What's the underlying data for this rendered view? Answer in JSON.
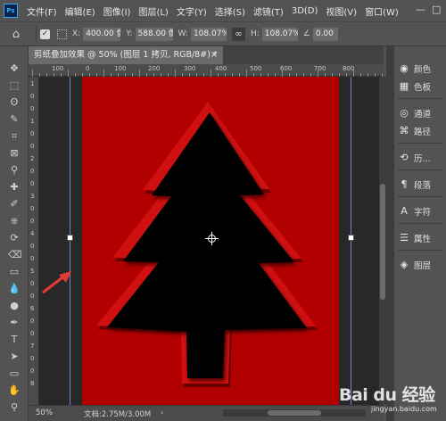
{
  "app": {
    "logo": "Ps"
  },
  "menu": [
    "文件(F)",
    "编辑(E)",
    "图像(I)",
    "图层(L)",
    "文字(Y)",
    "选择(S)",
    "滤镜(T)",
    "3D(D)",
    "视图(V)",
    "窗口(W)"
  ],
  "window_controls": {
    "minimize": "—",
    "maximize": "□"
  },
  "options": {
    "x_label": "X:",
    "x_value": "400.00 像素",
    "y_label": "Y:",
    "y_value": "588.00 像素",
    "w_label": "W:",
    "w_value": "108.07%",
    "h_label": "H:",
    "h_value": "108.07%",
    "angle_value": "0.00",
    "link_symbol": "∞"
  },
  "document": {
    "tab_title": "剪纸叠加效果 @ 50% (图层 1 拷贝, RGB/8#) *",
    "close": "×"
  },
  "ruler": {
    "top": [
      "100",
      "0",
      "100",
      "200",
      "300",
      "400",
      "500",
      "600",
      "700",
      "800"
    ],
    "left": [
      "1",
      "0",
      "0",
      "1",
      "0",
      "0",
      "2",
      "0",
      "0",
      "3",
      "0",
      "0",
      "4",
      "0",
      "0",
      "5",
      "0",
      "0",
      "6",
      "0",
      "0",
      "7",
      "0",
      "0",
      "8"
    ]
  },
  "status": {
    "zoom": "50%",
    "doc_size": "文档:2.75M/3.00M",
    "arrow": "›"
  },
  "panels": [
    {
      "icon": "palette-icon",
      "glyph": "◉",
      "label": "颜色"
    },
    {
      "icon": "swatches-icon",
      "glyph": "▦",
      "label": "色板"
    },
    {
      "icon": "channels-icon",
      "glyph": "◎",
      "label": "通道"
    },
    {
      "icon": "paths-icon",
      "glyph": "⌘",
      "label": "路径"
    },
    {
      "icon": "history-icon",
      "glyph": "⟲",
      "label": "历..."
    },
    {
      "icon": "paragraph-icon",
      "glyph": "¶",
      "label": "段落"
    },
    {
      "icon": "character-icon",
      "glyph": "A",
      "label": "字符"
    },
    {
      "icon": "properties-icon",
      "glyph": "☰",
      "label": "属性"
    },
    {
      "icon": "layers-icon",
      "glyph": "◈",
      "label": "图层"
    }
  ],
  "tools": [
    "move",
    "marquee",
    "lasso",
    "quick-select",
    "crop",
    "frame",
    "eyedropper",
    "healing",
    "brush",
    "clone-stamp",
    "history-brush",
    "eraser",
    "gradient",
    "blur",
    "dodge",
    "pen",
    "type",
    "path-select",
    "rectangle",
    "hand",
    "zoom"
  ],
  "tool_glyphs": [
    "✥",
    "⬚",
    "ʘ",
    "✎",
    "⌗",
    "⊠",
    "⚲",
    "✚",
    "✐",
    "⎈",
    "⟳",
    "⌫",
    "▭",
    "💧",
    "●",
    "✒",
    "T",
    "➤",
    "▭",
    "✋",
    "⚲"
  ],
  "watermark": {
    "main": "Bai du 经验",
    "sub": "jingyan.baidu.com"
  },
  "colors": {
    "canvas_red": "#b20000",
    "tree_black": "#050505",
    "guide_blue": "#6b86d6",
    "arrow_red": "#e53935"
  }
}
